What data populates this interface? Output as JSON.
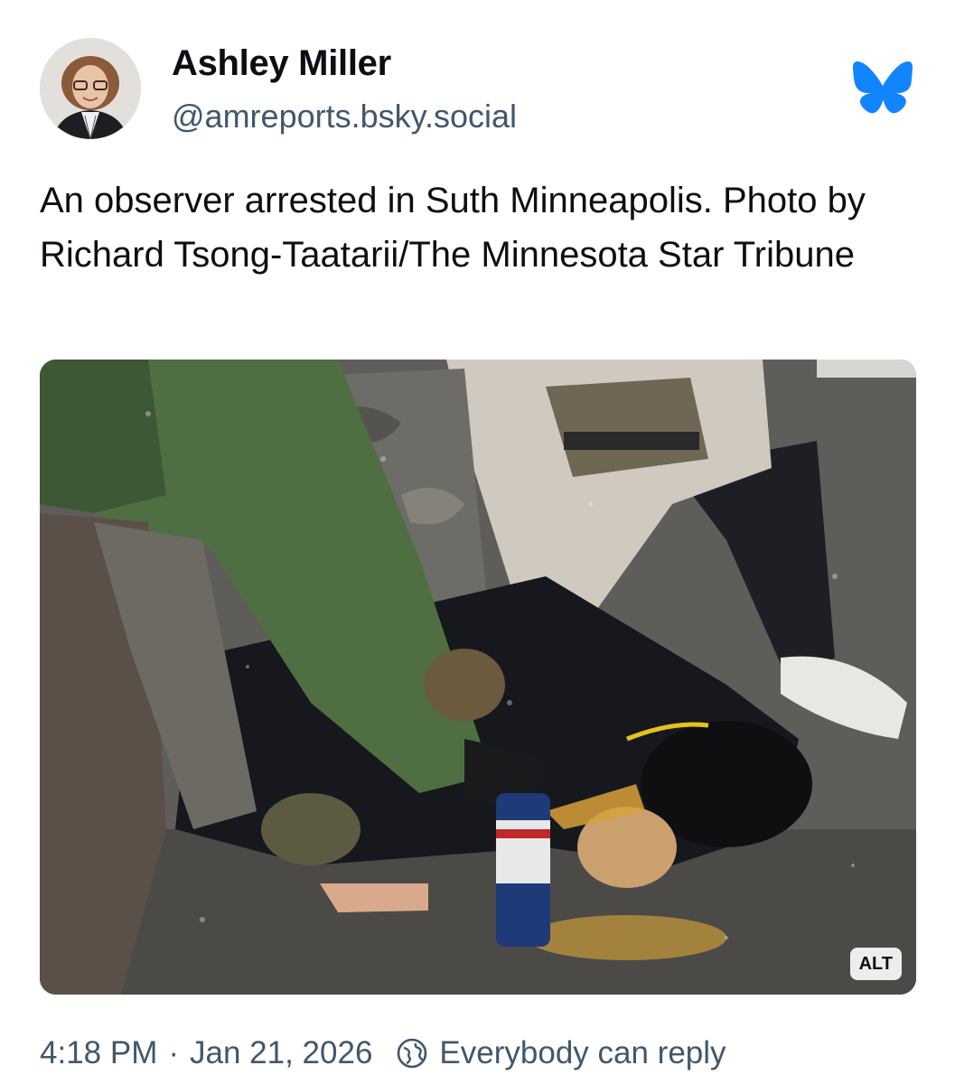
{
  "author": {
    "display_name": "Ashley Miller",
    "handle": "@amreports.bsky.social",
    "avatar": "profile-photo"
  },
  "app": {
    "logo": "bluesky-butterfly-icon",
    "brand_color": "#1185fe"
  },
  "post": {
    "text": "An observer arrested in Suth Minneapolis. Photo by Richard Tsong-Taatarii/The Minnesota Star Tribune",
    "image": {
      "alt_badge": "ALT"
    }
  },
  "meta": {
    "time": "4:18 PM",
    "separator": "·",
    "date": "Jan 21, 2026",
    "reply_icon": "globe-reply-icon",
    "reply_setting": "Everybody can reply"
  },
  "colors": {
    "text": "#0b0f14",
    "secondary_text": "#42576c"
  }
}
